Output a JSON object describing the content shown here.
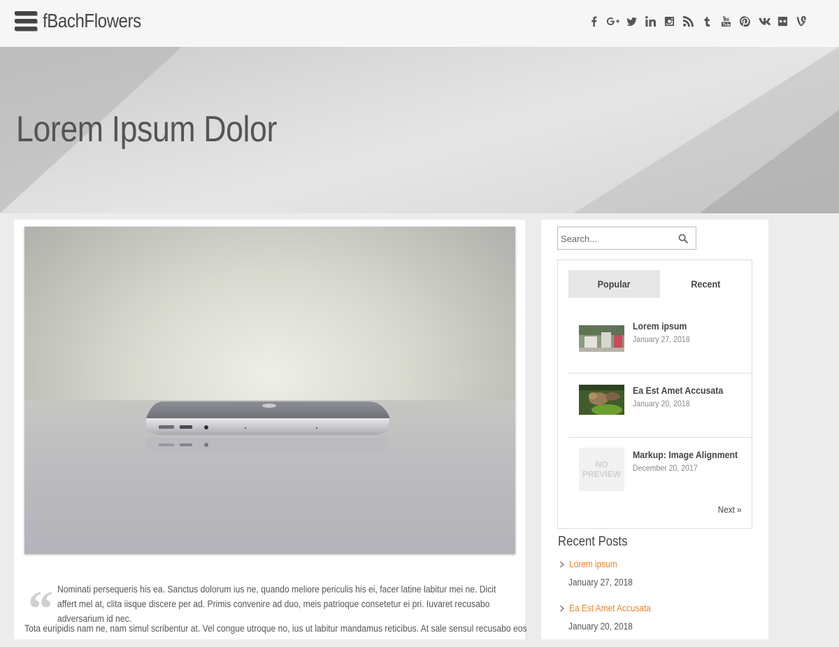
{
  "header": {
    "site_title": "fBachFlowers",
    "social_icons": [
      "facebook-icon",
      "google-plus-icon",
      "twitter-icon",
      "linkedin-icon",
      "instagram-icon",
      "rss-icon",
      "tumblr-icon",
      "youtube-icon",
      "pinterest-icon",
      "vk-icon",
      "flickr-icon",
      "vine-icon"
    ]
  },
  "hero": {
    "title": "Lorem Ipsum Dolor"
  },
  "article": {
    "quote": "Nominati persequeris his ea. Sanctus dolorum ius ne, quando meliore periculis his ei, facer latine labitur mei ne. Dicit affert mel at, clita iisque discere per ad. Primis convenire ad duo, meis patrioque consetetur ei pri. Iuvaret recusabo adversarium id nec.",
    "body_partial": "Tota euripidis nam ne, nam simul scribentur at. Vel congue utroque no, ius ut labitur mandamus reticibus. At sale sensul recusabo eos"
  },
  "sidebar": {
    "search_placeholder": "Search...",
    "tabs": [
      "Popular",
      "Recent"
    ],
    "active_tab": "Popular",
    "popular_posts": [
      {
        "title": "Lorem ipsum",
        "date": "January 27, 2018",
        "thumb": "photo"
      },
      {
        "title": "Ea Est Amet Accusata",
        "date": "January 20, 2018",
        "thumb": "photo"
      },
      {
        "title": "Markup: Image Alignment",
        "date": "December 20, 2017",
        "thumb": "none"
      }
    ],
    "no_preview_line1": "NO",
    "no_preview_line2": "PREVIEW",
    "next_label": "Next »",
    "recent_heading": "Recent Posts",
    "recent_posts": [
      {
        "title": "Lorem ipsum",
        "date": "January 27, 2018"
      },
      {
        "title": "Ea Est Amet Accusata",
        "date": "January 20, 2018"
      }
    ],
    "link_color": "#e8852a"
  }
}
